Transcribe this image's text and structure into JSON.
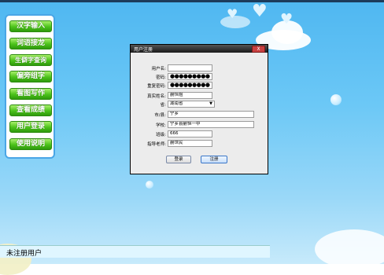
{
  "sidebar": {
    "items": [
      {
        "label": "汉字输入"
      },
      {
        "label": "词语接龙"
      },
      {
        "label": "生僻字查询"
      },
      {
        "label": "偏旁组字"
      },
      {
        "label": "看图写作"
      },
      {
        "label": "查看成绩"
      },
      {
        "label": "用户登录"
      },
      {
        "label": "使用说明"
      }
    ]
  },
  "dialog": {
    "title": "用户注册",
    "close_label": "X",
    "fields": {
      "username": {
        "label": "用户名:",
        "value": ""
      },
      "password": {
        "label": "密码:",
        "value": "●●●●●●●●●"
      },
      "confirm_password": {
        "label": "重复密码:",
        "value": "●●●●●●●●●"
      },
      "real_name": {
        "label": "真实姓名:",
        "value": "蒯恒煜"
      },
      "province": {
        "label": "省:",
        "value": "湖南省"
      },
      "city_county": {
        "label": "市/县:",
        "value": "宁乡"
      },
      "school": {
        "label": "学校:",
        "value": "宁乡县蒯恒一中"
      },
      "class": {
        "label": "班级:",
        "value": "666"
      },
      "teacher": {
        "label": "指导老师:",
        "value": "蒯世民"
      }
    },
    "buttons": {
      "login": "登录",
      "register": "注册"
    }
  },
  "statusbar": {
    "text": "未注册用户"
  },
  "icons": {
    "close": "close-icon",
    "dropdown": "chevron-down-icon"
  },
  "colors": {
    "sky_top": "#4fb7f1",
    "menu_green": "#4cc21b",
    "sidebar_border": "#4aa6e6"
  }
}
